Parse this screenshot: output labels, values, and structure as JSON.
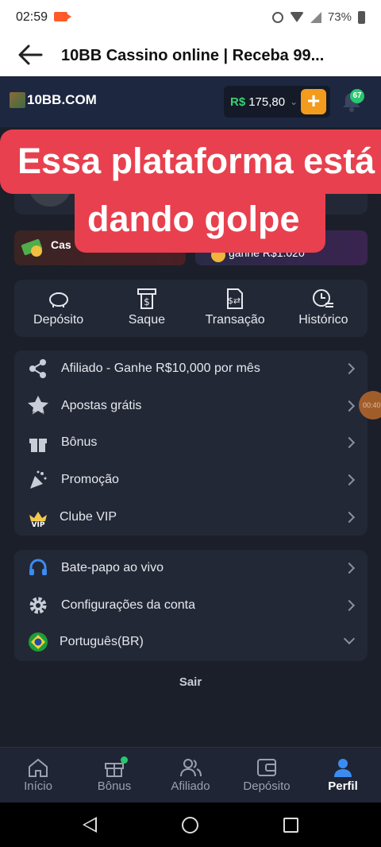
{
  "status_bar": {
    "time": "02:59",
    "battery": "73%"
  },
  "app_bar": {
    "title": "10BB Cassino online | Receba 99..."
  },
  "site_header": {
    "logo_text": "10BB.COM",
    "balance_currency": "R$",
    "balance_value": "175,80",
    "notification_count": "67",
    "plus_label": "+"
  },
  "overlay": {
    "line1": "Essa plataforma está",
    "line2": "dando golpe"
  },
  "promos": {
    "left_label": "Cas",
    "right_label": "ganhe R$1.020"
  },
  "quick_actions": [
    {
      "label": "Depósito",
      "icon": "piggy-bank-icon"
    },
    {
      "label": "Saque",
      "icon": "withdraw-icon"
    },
    {
      "label": "Transação",
      "icon": "transaction-icon"
    },
    {
      "label": "Histórico",
      "icon": "history-icon"
    }
  ],
  "menu_main": [
    {
      "label": "Afiliado - Ganhe R$10,000 por mês",
      "icon": "share-icon"
    },
    {
      "label": "Apostas grátis",
      "icon": "star-free-icon"
    },
    {
      "label": "Bônus",
      "icon": "gift-icon"
    },
    {
      "label": "Promoção",
      "icon": "party-popper-icon"
    },
    {
      "label": "Clube VIP",
      "icon": "vip-crown-icon"
    }
  ],
  "menu_secondary": [
    {
      "label": "Bate-papo ao vivo",
      "icon": "headset-icon"
    },
    {
      "label": "Configurações da conta",
      "icon": "settings-gear-icon"
    },
    {
      "label": "Português(BR)",
      "icon": "brazil-flag-icon"
    }
  ],
  "logout_label": "Sair",
  "float_timer": "00:40",
  "bottom_nav": [
    {
      "label": "Início",
      "icon": "home-icon",
      "active": false
    },
    {
      "label": "Bônus",
      "icon": "gift-icon",
      "active": false
    },
    {
      "label": "Afiliado",
      "icon": "users-icon",
      "active": false
    },
    {
      "label": "Depósito",
      "icon": "wallet-icon",
      "active": false
    },
    {
      "label": "Perfil",
      "icon": "profile-icon",
      "active": true
    }
  ],
  "colors": {
    "accent_orange": "#f29b1d",
    "overlay_red": "#e8404e",
    "active_blue": "#3b8cf0",
    "green": "#28c76f"
  }
}
